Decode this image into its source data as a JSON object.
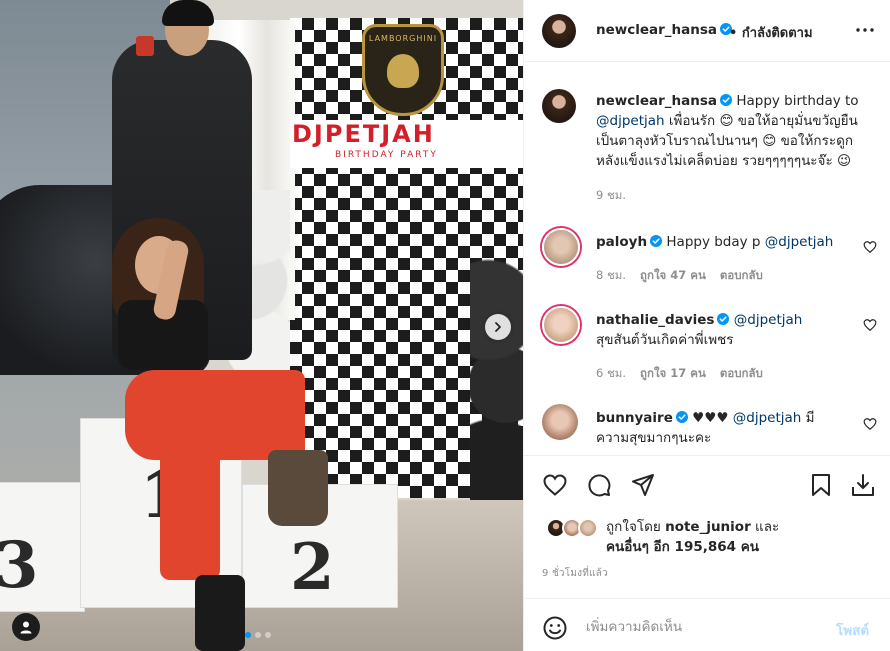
{
  "post": {
    "slide_count": 3,
    "active_slide": 1
  },
  "header": {
    "username": "newclear_hansa",
    "separator": "•",
    "follow_state": "กำลังติดตาม"
  },
  "caption": {
    "username": "newclear_hansa",
    "text_1": "Happy birthday to",
    "mention": "@djpetjah",
    "text_2": "เพื่อนรัก 😊 ขอให้อายุมั่นขวัญยืน",
    "line_2": "เป็นตาลุงหัวโบราณไปนานๆ 😊 ขอให้กระดูก",
    "line_3": "หลังแข็งแรงไม่เคล็ดบ่อย รวยๆๆๆๆๆนะจ๊ะ 😉",
    "time": "9 ชม."
  },
  "comments": [
    {
      "username": "paloyh",
      "text": "Happy bday p",
      "mention": "@djpetjah",
      "time": "8 ชม.",
      "likes": "ถูกใจ 47 คน",
      "reply": "ตอบกลับ"
    },
    {
      "username": "nathalie_davies",
      "mention": "@djpetjah",
      "text": "สุขสันต์วันเกิดค่าพี่เพชร",
      "time": "6 ชม.",
      "likes": "ถูกใจ 17 คน",
      "reply": "ตอบกลับ"
    },
    {
      "username": "bunnyaire",
      "text_1": "♥♥♥",
      "mention": "@djpetjah",
      "text_2": "มี",
      "text_3": "ความสุขมากๆนะคะ"
    }
  ],
  "likes": {
    "prefix": "ถูกใจโดย",
    "user": "note_junior",
    "and": "และ",
    "others_prefix": "คนอื่นๆ อีก",
    "count": "195,864",
    "suffix": "คน"
  },
  "timestamp": "9 ชั่วโมงที่แล้ว",
  "composer": {
    "placeholder": "เพิ่มความคิดเห็น",
    "post_label": "โพสต์"
  },
  "icons": {
    "header_more": "more-horizontal-icon",
    "like": "heart-icon",
    "comment": "comment-icon",
    "share": "send-icon",
    "save": "bookmark-icon",
    "download": "download-icon",
    "emoji": "emoji-icon",
    "verified": "verified-badge-icon",
    "next": "chevron-right-icon",
    "tags": "user-tag-icon"
  },
  "colors": {
    "verified": "#0095f6",
    "mention": "#00376b",
    "muted": "#8e8e8e",
    "post_disabled": "#b2dffc",
    "story_ring": "#e1306c"
  }
}
